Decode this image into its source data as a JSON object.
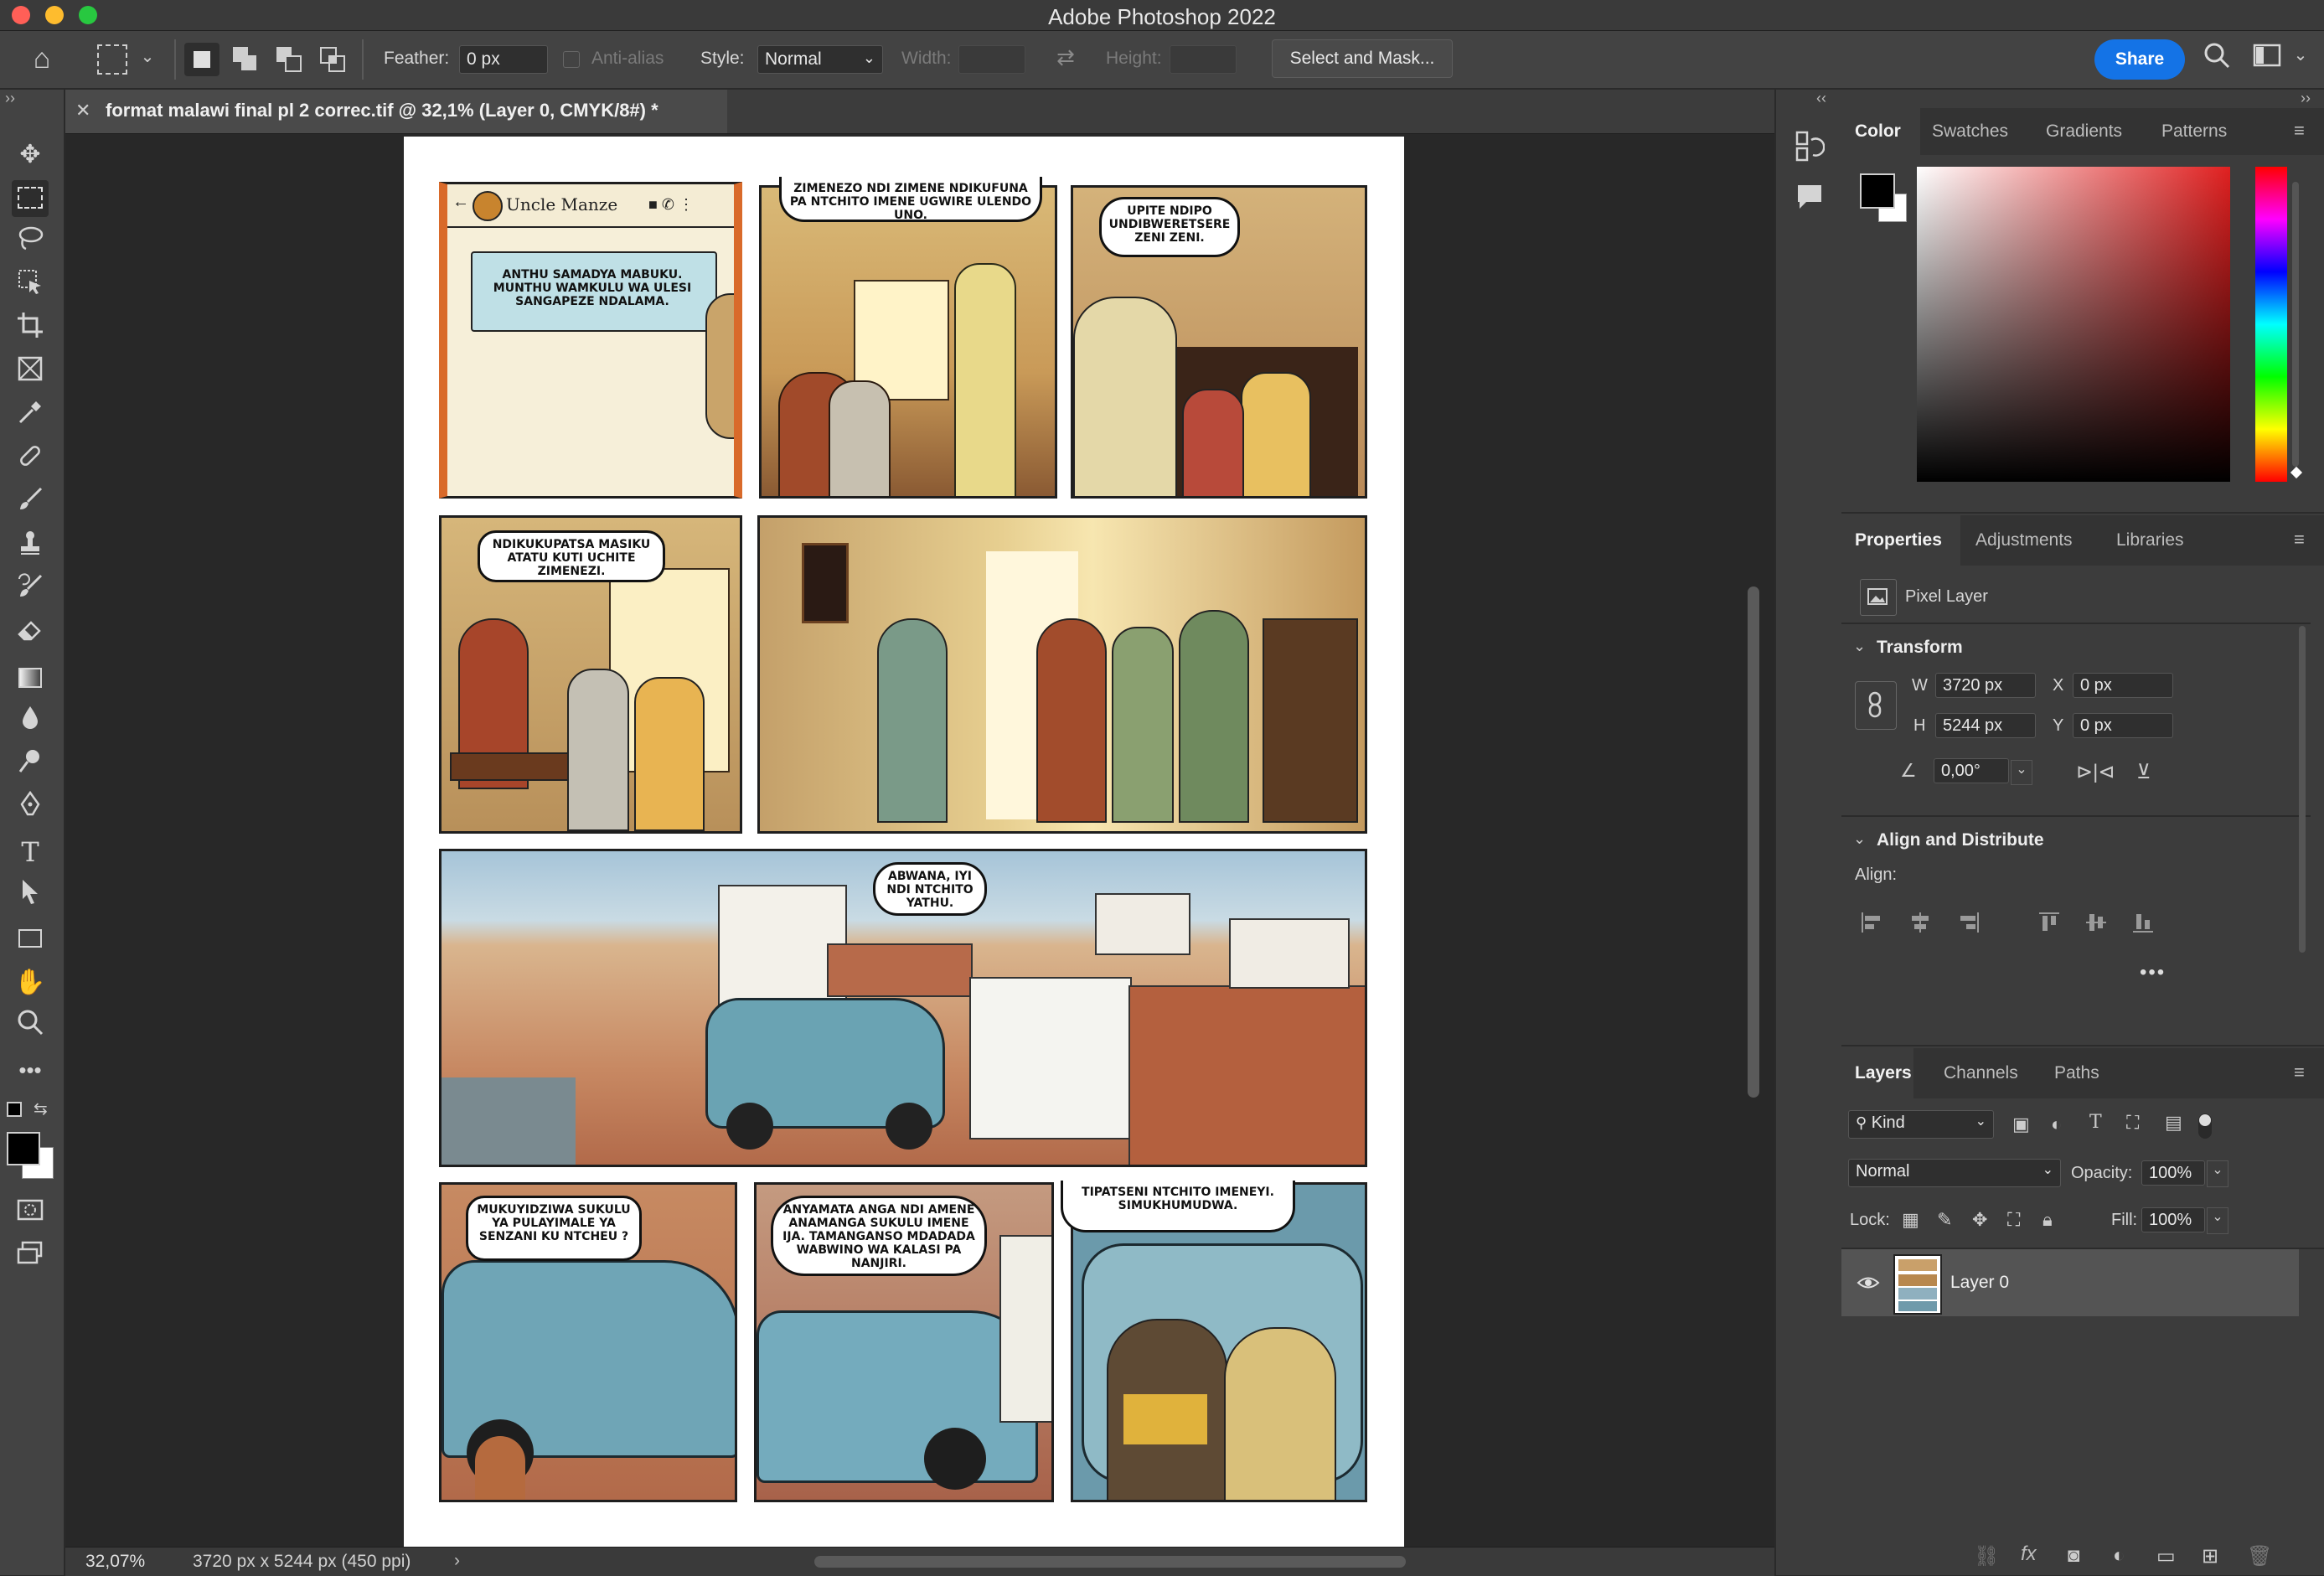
{
  "app": {
    "title": "Adobe Photoshop 2022"
  },
  "options_bar": {
    "feather_label": "Feather:",
    "feather_value": "0 px",
    "anti_alias_label": "Anti-alias",
    "style_label": "Style:",
    "style_value": "Normal",
    "width_label": "Width:",
    "height_label": "Height:",
    "select_mask_label": "Select and Mask...",
    "share_label": "Share"
  },
  "document": {
    "tab_title": "format malawi final pl 2 correc.tif @ 32,1% (Layer 0, CMYK/8#) *",
    "zoom": "32,07%",
    "dimensions": "3720 px x 5244 px (450 ppi)"
  },
  "comic": {
    "phone_contact": "Uncle Manze",
    "p1_caption": "ANTHU SAMADYA MABUKU. MUNTHU WAMKULU WA ULESI SANGAPEZE NDALAMA.",
    "p2_caption": "ZIMENEZO NDI ZIMENE NDIKUFUNA PA NTCHITO IMENE UGWIRE ULENDO UNO.",
    "p3_bubble": "UPITE NDIPO UNDIBWERETSERE ZENI ZENI.",
    "p4_bubble": "NDIKUKUPATSA MASIKU ATATU KUTI UCHITE ZIMENEZI.",
    "p6_bubble": "ABWANA, IYI NDI NTCHITO YATHU.",
    "p7_bubble": "MUKUYIDZIWA SUKULU YA PULAYIMALE YA SENZANI KU NTCHEU ?",
    "p8_bubble": "ANYAMATA ANGA NDI AMENE ANAMANGA SUKULU IMENE IJA. TAMANGANSO MDADADA WABWINO WA KALASI PA NANJIRI.",
    "p9_caption": "TIPATSENI NTCHITO IMENEYI. SIMUKHUMUDWA."
  },
  "color_panel": {
    "tabs": [
      "Color",
      "Swatches",
      "Gradients",
      "Patterns"
    ]
  },
  "properties_panel": {
    "tabs": [
      "Properties",
      "Adjustments",
      "Libraries"
    ],
    "layer_type": "Pixel Layer",
    "transform_label": "Transform",
    "w_label": "W",
    "w_value": "3720 px",
    "h_label": "H",
    "h_value": "5244 px",
    "x_label": "X",
    "x_value": "0 px",
    "y_label": "Y",
    "y_value": "0 px",
    "angle_value": "0,00°",
    "align_header": "Align and Distribute",
    "align_label": "Align:"
  },
  "layers_panel": {
    "tabs": [
      "Layers",
      "Channels",
      "Paths"
    ],
    "kind_label": "Kind",
    "blend_mode": "Normal",
    "opacity_label": "Opacity:",
    "opacity_value": "100%",
    "lock_label": "Lock:",
    "fill_label": "Fill:",
    "fill_value": "100%",
    "layers": [
      {
        "name": "Layer 0"
      }
    ]
  },
  "colors": {
    "accent": "#1473e6",
    "fg": "#000000",
    "bg": "#ffffff"
  }
}
